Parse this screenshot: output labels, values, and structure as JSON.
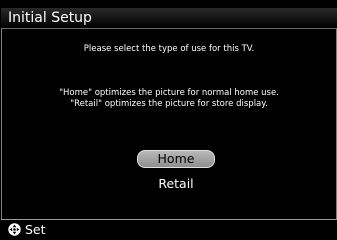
{
  "header": {
    "title": "Initial Setup"
  },
  "main": {
    "prompt": "Please select the type of use for this TV.",
    "description": [
      "\"Home\" optimizes the picture for normal home use.",
      "\"Retail\" optimizes the picture for store display."
    ],
    "options": [
      {
        "label": "Home",
        "selected": true
      },
      {
        "label": "Retail",
        "selected": false
      }
    ]
  },
  "footer": {
    "icon": "dpad-icon",
    "set_label": "Set"
  },
  "colors": {
    "background": "#000000",
    "frame_gray": "#c8c8c8",
    "selected_option": "#a8a8a8",
    "text": "#ffffff"
  }
}
